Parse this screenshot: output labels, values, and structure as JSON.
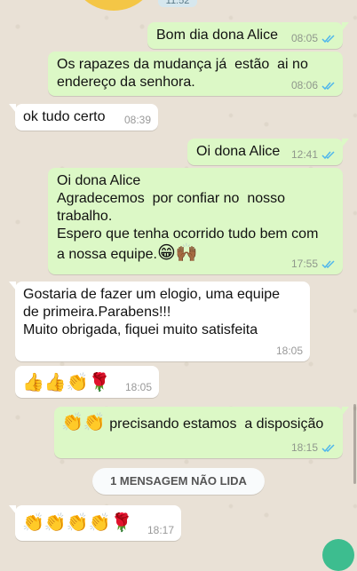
{
  "header": {
    "timestamp_pill": "11:52"
  },
  "messages": [
    {
      "direction": "out",
      "text": "Bom dia dona Alice",
      "time": "08:05",
      "status": "read"
    },
    {
      "direction": "out",
      "text": "Os rapazes da mudança já  estão  ai no\nendereço da senhora.",
      "time": "08:06",
      "status": "read"
    },
    {
      "direction": "in",
      "text": "ok tudo certo",
      "time": "08:39"
    },
    {
      "direction": "out",
      "text": "Oi dona Alice",
      "time": "12:41",
      "status": "read"
    },
    {
      "direction": "out",
      "text": "Oi dona Alice\nAgradecemos  por confiar no  nosso\ntrabalho.\nEspero que tenha ocorrido tudo bem com\na nossa equipe.",
      "emoji": "😁🙌🏾",
      "time": "17:55",
      "status": "read"
    },
    {
      "direction": "in",
      "text": "Gostaria de fazer um elogio, uma equipe\nde primeira.Parabens!!!\nMuito obrigada, fiquei muito satisfeita",
      "time": "18:05"
    },
    {
      "direction": "in",
      "emoji": "👍👍👏🌹",
      "time": "18:05"
    },
    {
      "direction": "out",
      "emoji": "👏👏",
      "text": " precisando estamos  a disposição",
      "time": "18:15",
      "status": "read"
    },
    {
      "direction": "in",
      "emoji": "👏👏👏👏🌹",
      "time": "18:17"
    }
  ],
  "unread_banner": "1 MENSAGEM NÃO LIDA",
  "colors": {
    "outgoing": "#dcf8c6",
    "incoming": "#ffffff",
    "read_ticks": "#4fb6ec",
    "accent": "#3dbd8f"
  },
  "icons": {
    "read_receipt": "double-check-icon",
    "scroll_down": "scroll-down-icon"
  }
}
